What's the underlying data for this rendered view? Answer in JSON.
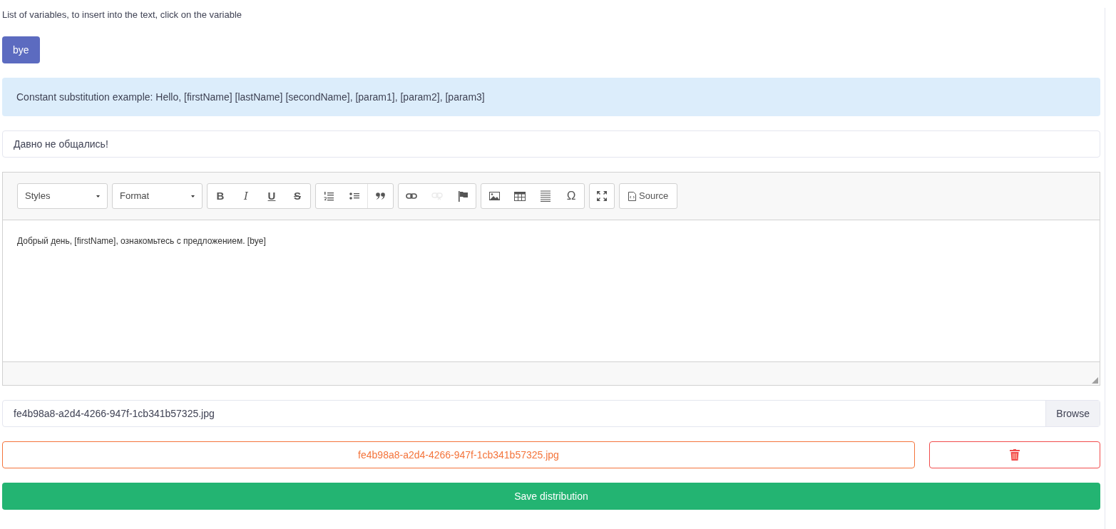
{
  "variables_hint": "List of variables, to insert into the text, click on the variable",
  "variables": [
    {
      "label": "bye"
    }
  ],
  "info": "Constant substitution example: Hello, [firstName] [lastName] [secondName], [param1], [param2], [param3]",
  "subject": {
    "value": "Давно не общались!"
  },
  "editor": {
    "dropdowns": [
      {
        "label": "Styles"
      },
      {
        "label": "Format"
      }
    ],
    "groups": [
      {
        "buttons": [
          {
            "kind": "bold",
            "label": "B",
            "disabled": false
          },
          {
            "kind": "italic",
            "label": "I",
            "disabled": false
          },
          {
            "kind": "underline",
            "label": "U",
            "disabled": false
          },
          {
            "kind": "strike",
            "label": "S",
            "disabled": false
          }
        ]
      },
      {
        "buttons": [
          {
            "kind": "numbered-list",
            "disabled": false
          },
          {
            "kind": "bulleted-list",
            "disabled": false
          },
          {
            "kind": "quote",
            "disabled": false
          }
        ]
      },
      {
        "buttons": [
          {
            "kind": "link",
            "disabled": false
          },
          {
            "kind": "unlink",
            "disabled": true
          },
          {
            "kind": "flag",
            "disabled": false
          }
        ]
      },
      {
        "buttons": [
          {
            "kind": "image",
            "disabled": false
          },
          {
            "kind": "table",
            "disabled": false
          },
          {
            "kind": "lines",
            "disabled": false
          },
          {
            "kind": "symbol",
            "label": "Ω",
            "disabled": false
          }
        ]
      },
      {
        "buttons": [
          {
            "kind": "maximize",
            "disabled": false
          }
        ]
      },
      {
        "buttons": [
          {
            "kind": "source",
            "label": "Source",
            "disabled": false
          }
        ]
      }
    ],
    "content": "Добрый день, [firstName], ознакомьтесь с предложением. [bye]"
  },
  "file": {
    "value": "fe4b98a8-a2d4-4266-947f-1cb341b57325.jpg",
    "browse": "Browse"
  },
  "attachment": {
    "label": "fe4b98a8-a2d4-4266-947f-1cb341b57325.jpg"
  },
  "save": "Save distribution"
}
